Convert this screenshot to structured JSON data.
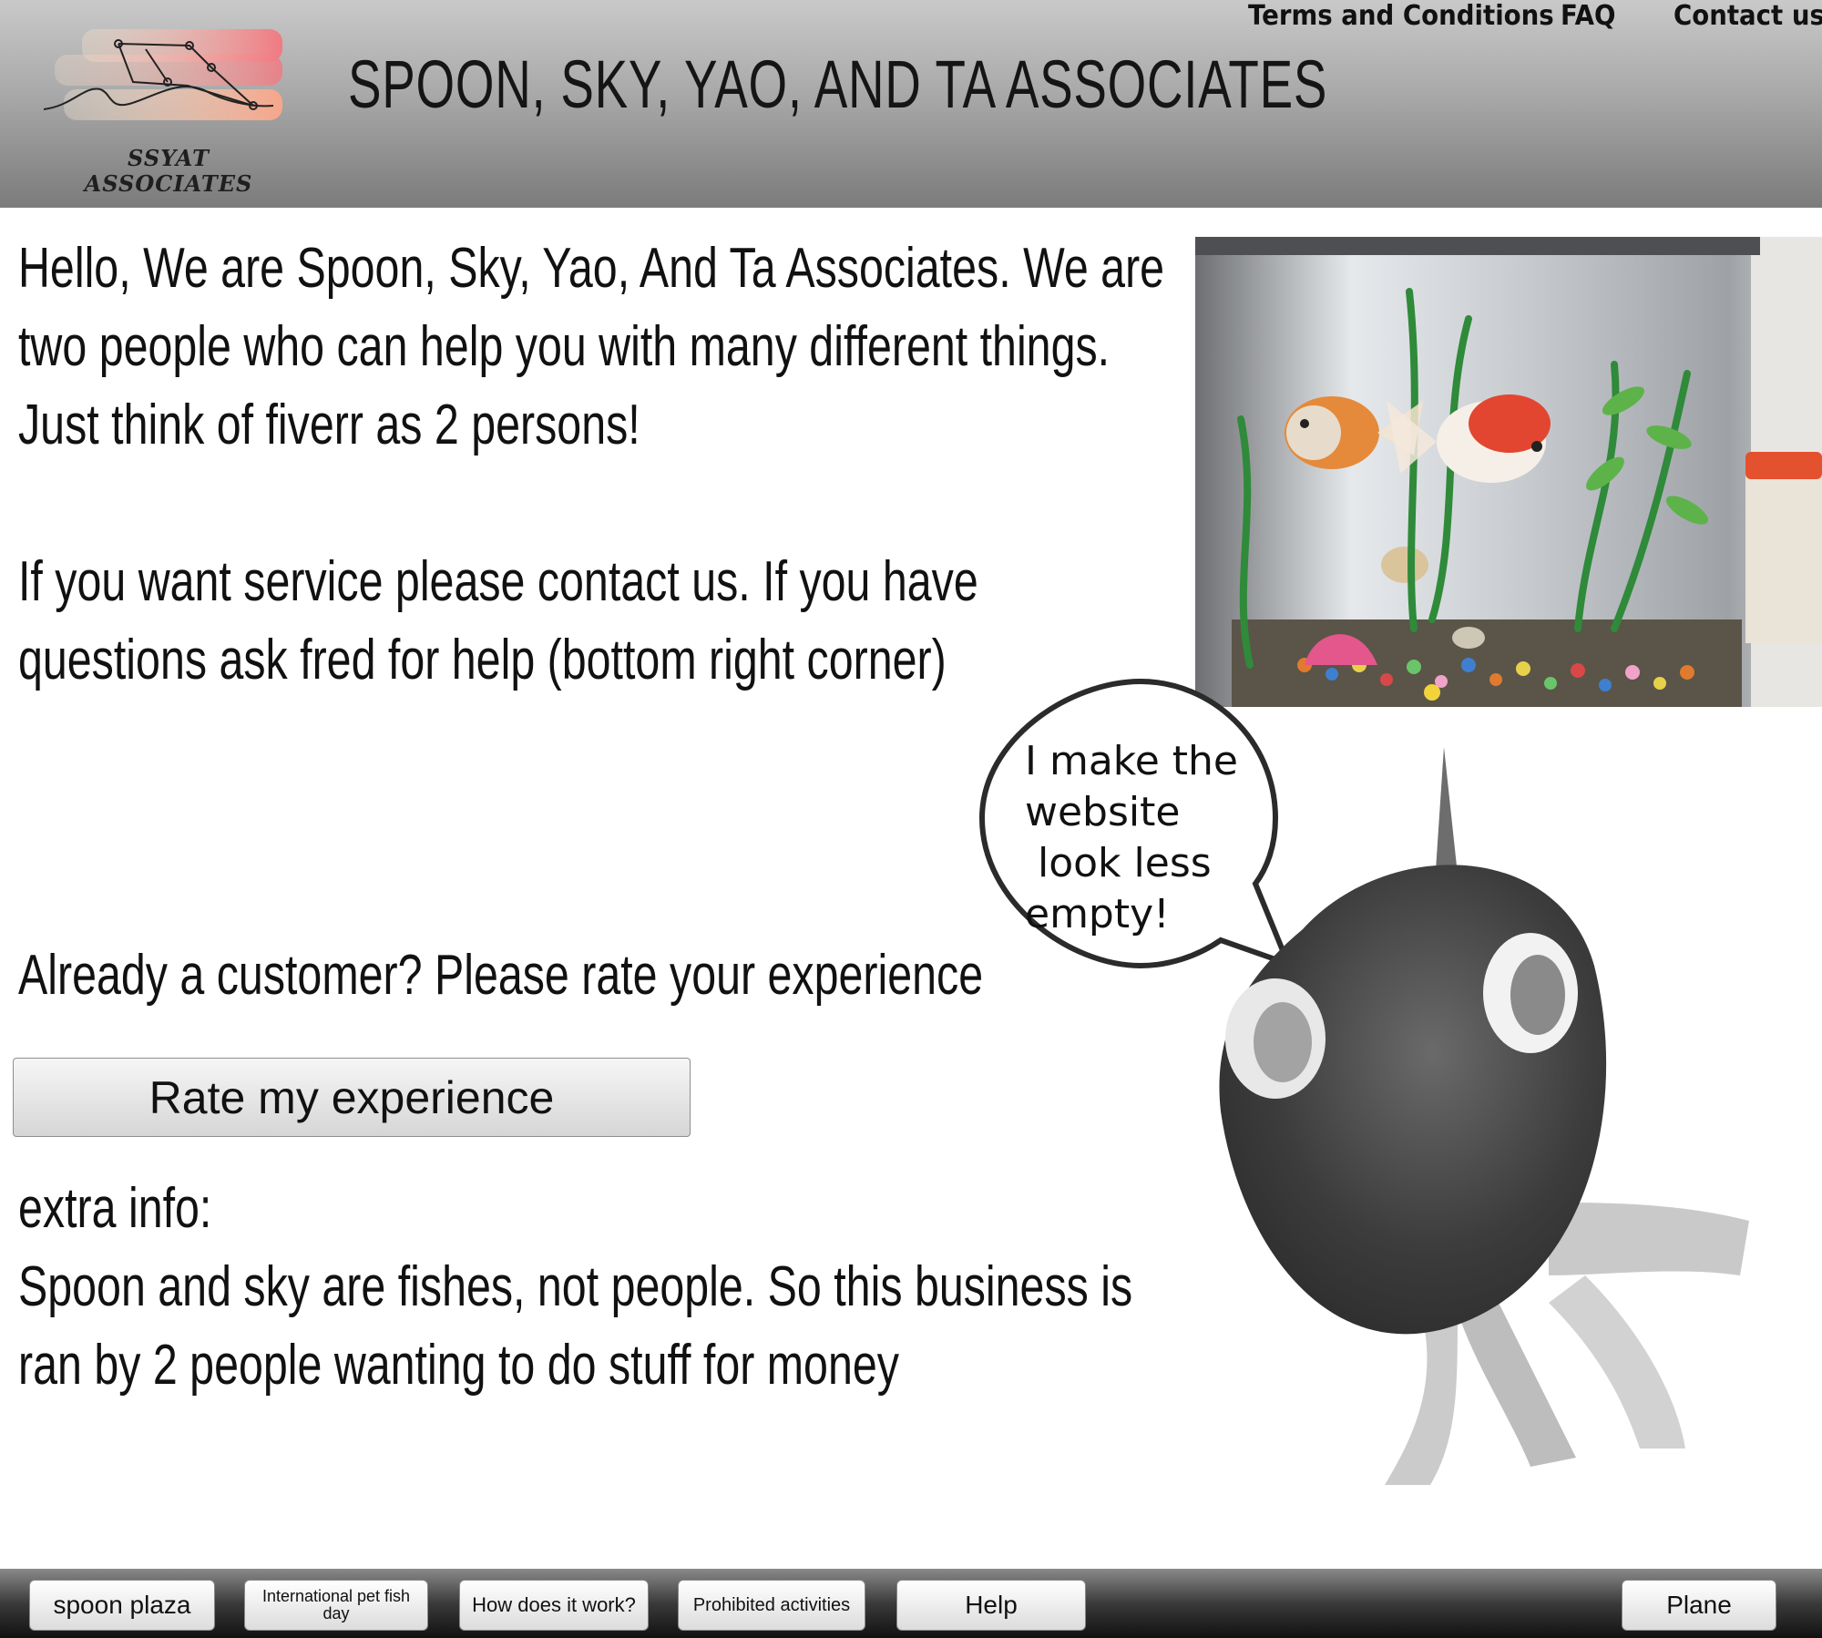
{
  "header": {
    "title": "SPOON, SKY, YAO, AND TA ASSOCIATES",
    "logo_text_line1": "SSYAT",
    "logo_text_line2": "ASSOCIATES",
    "nav": {
      "terms": "Terms and Conditions",
      "faq": "FAQ",
      "contact": "Contact us"
    }
  },
  "intro": {
    "line1": "Hello, We are Spoon, Sky, Yao, And Ta Associates. We are",
    "line2": "two people who can help you with many different things.",
    "line3": "Just think of fiverr as 2 persons!"
  },
  "service": {
    "line1": "If you want service please contact us. If you have",
    "line2": "questions ask fred for help (bottom right corner)"
  },
  "rating": {
    "prompt": "Already a customer? Please rate your experience",
    "button": "Rate my experience"
  },
  "extra": {
    "heading": "extra info:",
    "line1": "Spoon and sky are fishes, not people. So this business is",
    "line2": "ran by 2 people wanting to do stuff for money"
  },
  "speech_bubble": {
    "text": "I make the\nwebsite\n look less\nempty!"
  },
  "footer": {
    "buttons": [
      "spoon plaza",
      "International pet fish day",
      "How does it work?",
      "Prohibited activities",
      "Help",
      "Plane"
    ]
  },
  "colors": {
    "header_gradient_top": "#c9c9c9",
    "header_gradient_bottom": "#7b7b7b",
    "footer_bar": "#2a2a2a",
    "button_face": "#e6e6e6"
  }
}
